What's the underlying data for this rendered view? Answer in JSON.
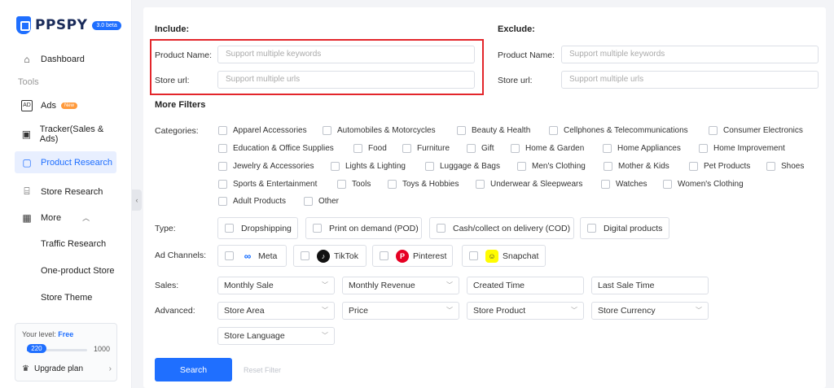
{
  "brand": {
    "name": "PPSPY",
    "beta": "3.0 beta"
  },
  "sidebar": {
    "dashboard": "Dashboard",
    "tools_label": "Tools",
    "ads": "Ads",
    "ads_badge": "New",
    "tracker": "Tracker(Sales & Ads)",
    "product_research": "Product Research",
    "store_research": "Store Research",
    "more": "More",
    "traffic_research": "Traffic Research",
    "one_product_store": "One-product Store",
    "store_theme": "Store Theme"
  },
  "level": {
    "label": "Your level:",
    "value": "Free",
    "current": "220",
    "max": "1000",
    "progress": 0.22,
    "upgrade": "Upgrade plan"
  },
  "include": {
    "heading": "Include:",
    "product_name_label": "Product Name:",
    "product_name_placeholder": "Support multiple keywords",
    "store_url_label": "Store url:",
    "store_url_placeholder": "Support multiple urls"
  },
  "exclude": {
    "heading": "Exclude:",
    "product_name_label": "Product Name:",
    "product_name_placeholder": "Support multiple keywords",
    "store_url_label": "Store url:",
    "store_url_placeholder": "Support multiple urls"
  },
  "filters": {
    "heading": "More Filters",
    "categories_label": "Categories:",
    "categories": [
      "Apparel Accessories",
      "Automobiles & Motorcycles",
      "Beauty & Health",
      "Cellphones & Telecommunications",
      "Consumer Electronics",
      "Education & Office Supplies",
      "Food",
      "Furniture",
      "Gift",
      "Home & Garden",
      "Home Appliances",
      "Home Improvement",
      "Jewelry & Accessories",
      "Lights & Lighting",
      "Luggage & Bags",
      "Men's Clothing",
      "Mother & Kids",
      "Pet Products",
      "Shoes",
      "Sports & Entertainment",
      "Tools",
      "Toys & Hobbies",
      "Underwear & Sleepwears",
      "Watches",
      "Women's Clothing",
      "Adult Products",
      "Other"
    ],
    "type_label": "Type:",
    "types": [
      "Dropshipping",
      "Print on demand (POD)",
      "Cash/collect on delivery (COD)",
      "Digital products"
    ],
    "channels_label": "Ad Channels:",
    "channels": [
      "Meta",
      "TikTok",
      "Pinterest",
      "Snapchat"
    ],
    "sales_label": "Sales:",
    "sales": [
      "Monthly Sale",
      "Monthly Revenue",
      "Created Time",
      "Last Sale Time"
    ],
    "advanced_label": "Advanced:",
    "advanced": [
      "Store Area",
      "Price",
      "Store Product",
      "Store Currency",
      "Store Language"
    ],
    "search": "Search",
    "reset": "Reset Filter"
  },
  "colors": {
    "accent": "#1f6fff",
    "highlight": "#e3262b"
  }
}
